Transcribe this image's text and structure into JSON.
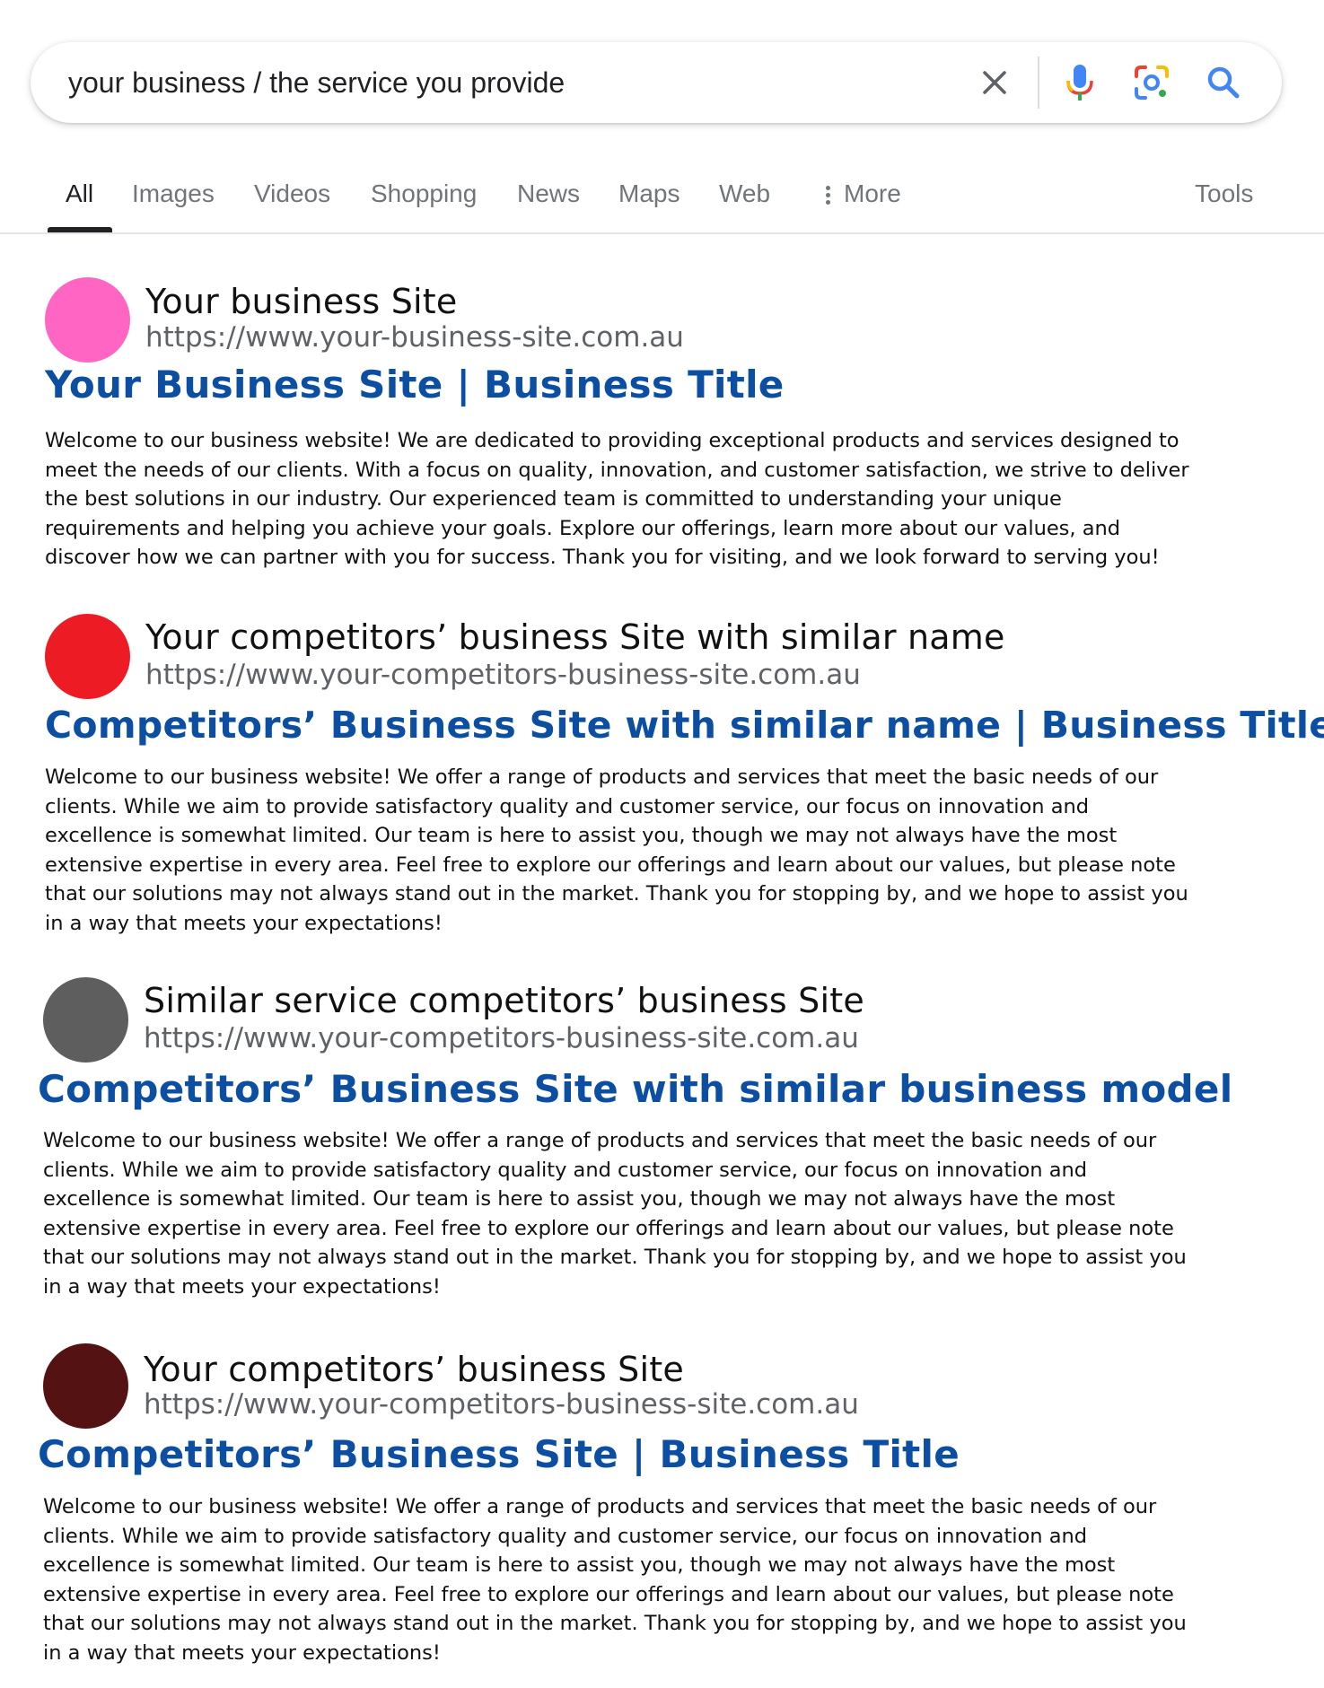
{
  "search": {
    "query": "your business / the service you provide",
    "clear_icon": "close-icon",
    "mic_icon": "microphone-icon",
    "lens_icon": "google-lens-icon",
    "search_icon": "magnifier-icon"
  },
  "tabs": [
    {
      "label": "All",
      "active": true
    },
    {
      "label": "Images"
    },
    {
      "label": "Videos"
    },
    {
      "label": "Shopping"
    },
    {
      "label": "News"
    },
    {
      "label": "Maps"
    },
    {
      "label": "Web"
    },
    {
      "label": "More",
      "icon": "more-vert-icon"
    },
    {
      "label": "Tools"
    }
  ],
  "results": [
    {
      "favicon_color": "#ff66c4",
      "site_name": "Your business Site",
      "url": "https://www.your-business-site.com.au",
      "title": "Your Business Site | Business Title",
      "snippet_lines": [
        "Welcome to our business website! We are dedicated to providing exceptional products and services designed to",
        "meet the needs of our clients. With a focus on quality, innovation, and customer satisfaction, we strive to deliver",
        "the best solutions in our industry. Our experienced team is committed to understanding your unique",
        "requirements and helping you achieve your goals. Explore our offerings, learn more about our values, and",
        "discover how we can partner with you for success. Thank you for visiting, and we look forward to serving you!"
      ]
    },
    {
      "favicon_color": "#ed1c24",
      "site_name": "Your competitors’ business Site with similar name",
      "url": "https://www.your-competitors-business-site.com.au",
      "title": "Competitors’ Business Site with similar name | Business Title",
      "snippet_lines": [
        "Welcome to our business website! We offer a range of products and services that meet the basic needs of our",
        "clients. While we aim to provide satisfactory quality and customer service, our focus on innovation and",
        "excellence is somewhat limited. Our team is here to assist you, though we may not always have the most",
        "extensive expertise in every area. Feel free to explore our offerings and learn about our values, but please note",
        "that our solutions may not always stand out in the market. Thank you for stopping by, and we hope to assist you",
        "in a way that meets your expectations!"
      ]
    },
    {
      "favicon_color": "#5e5e5e",
      "site_name": "Similar service competitors’ business Site",
      "url": "https://www.your-competitors-business-site.com.au",
      "title": "Competitors’ Business Site with similar business model",
      "snippet_lines": [
        "Welcome to our business website! We offer a range of products and services that meet the basic needs of our",
        "clients. While we aim to provide satisfactory quality and customer service, our focus on innovation and",
        "excellence is somewhat limited. Our team is here to assist you, though we may not always have the most",
        "extensive expertise in every area. Feel free to explore our offerings and learn about our values, but please note",
        "that our solutions may not always stand out in the market. Thank you for stopping by, and we hope to assist you",
        "in a way that meets your expectations!"
      ]
    },
    {
      "favicon_color": "#541212",
      "site_name": "Your competitors’ business Site",
      "url": "https://www.your-competitors-business-site.com.au",
      "title": "Competitors’ Business Site | Business Title",
      "snippet_lines": [
        "Welcome to our business website! We offer a range of products and services that meet the basic needs of our",
        "clients. While we aim to provide satisfactory quality and customer service, our focus on innovation and",
        "excellence is somewhat limited. Our team is here to assist you, though we may not always have the most",
        "extensive expertise in every area. Feel free to explore our offerings and learn about our values, but please note",
        "that our solutions may not always stand out in the market. Thank you for stopping by, and we hope to assist you",
        "in a way that meets your expectations!"
      ]
    }
  ]
}
